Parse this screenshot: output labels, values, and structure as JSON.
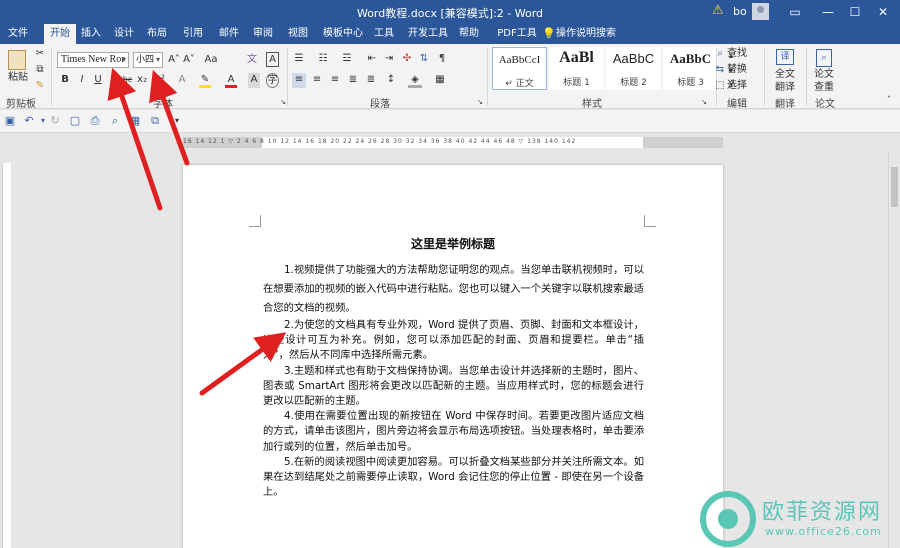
{
  "window": {
    "title": "Word教程.docx [兼容模式]:2  -  Word",
    "user": "bo",
    "buttons": [
      "▭",
      "—",
      "☐",
      "✕"
    ]
  },
  "menu": {
    "tabs": [
      "文件",
      "开始",
      "插入",
      "设计",
      "布局",
      "引用",
      "邮件",
      "审阅",
      "视图",
      "模板中心",
      "工具",
      "开发工具",
      "帮助",
      "PDF工具集"
    ],
    "active": "开始",
    "tell_me": "操作说明搜索"
  },
  "ribbon": {
    "clipboard": {
      "paste": "粘贴",
      "label": "剪贴板"
    },
    "font": {
      "name": "Times New Ror",
      "size": "小四",
      "grow": "A˄",
      "shrink": "A˅",
      "case": "Aa",
      "bold": "B",
      "italic": "I",
      "underline": "U",
      "strike": "abc",
      "sub": "x₂",
      "sup": "x²",
      "clear": "A",
      "label": "字体"
    },
    "paragraph": {
      "label": "段落"
    },
    "styles": {
      "items": [
        {
          "sample": "AaBbCcI",
          "name": "↵ 正文"
        },
        {
          "sample": "AaBl",
          "name": "标题 1"
        },
        {
          "sample": "AaBbC",
          "name": "标题 2"
        },
        {
          "sample": "AaBbC",
          "name": "标题 3"
        }
      ],
      "label": "样式"
    },
    "editing": {
      "find": "查找",
      "replace": "替换",
      "select": "选择",
      "label": "编辑"
    },
    "translate": {
      "line1": "全文",
      "line2": "翻译",
      "label": "翻译"
    },
    "paper": {
      "line1": "论文",
      "line2": "查重",
      "label": "论文"
    }
  },
  "ruler": {
    "ticks": "16   14   12   1    ▽   2   4   6   8   10   12   14   16   18   20   22   24   26   28   30   32   34   36   38   40   42   44   46   48   ▽   138   140   142"
  },
  "document": {
    "title": "这里是举例标题",
    "paragraphs": [
      "1.视频提供了功能强大的方法帮助您证明您的观点。当您单击联机视频时，可以在想要添加的视频的嵌入代码中进行粘贴。您也可以键入一个关键字以联机搜索最适合您的文档的视频。",
      "2.为使您的文档具有专业外观，Word 提供了页眉、页脚、封面和文本框设计，这些设计可互为补充。例如，您可以添加匹配的封面、页眉和提要栏。单击“插入”，然后从不同库中选择所需元素。",
      "3.主题和样式也有助于文档保持协调。当您单击设计并选择新的主题时，图片、图表或 SmartArt 图形将会更改以匹配新的主题。当应用样式时，您的标题会进行更改以匹配新的主题。",
      "4.使用在需要位置出现的新按钮在 Word 中保存时间。若要更改图片适应文档的方式，请单击该图片，图片旁边将会显示布局选项按钮。当处理表格时，单击要添加行或列的位置，然后单击加号。",
      "5.在新的阅读视图中阅读更加容易。可以折叠文档某些部分并关注所需文本。如果在达到结尾处之前需要停止读取，Word 会记住您的停止位置 - 即使在另一个设备上。"
    ]
  },
  "watermark": {
    "text": "欧菲资源网",
    "url": "www.office26.com"
  },
  "colors": {
    "accent": "#2b579a",
    "arrow": "#e02020",
    "watermark": "#59c6b6"
  }
}
